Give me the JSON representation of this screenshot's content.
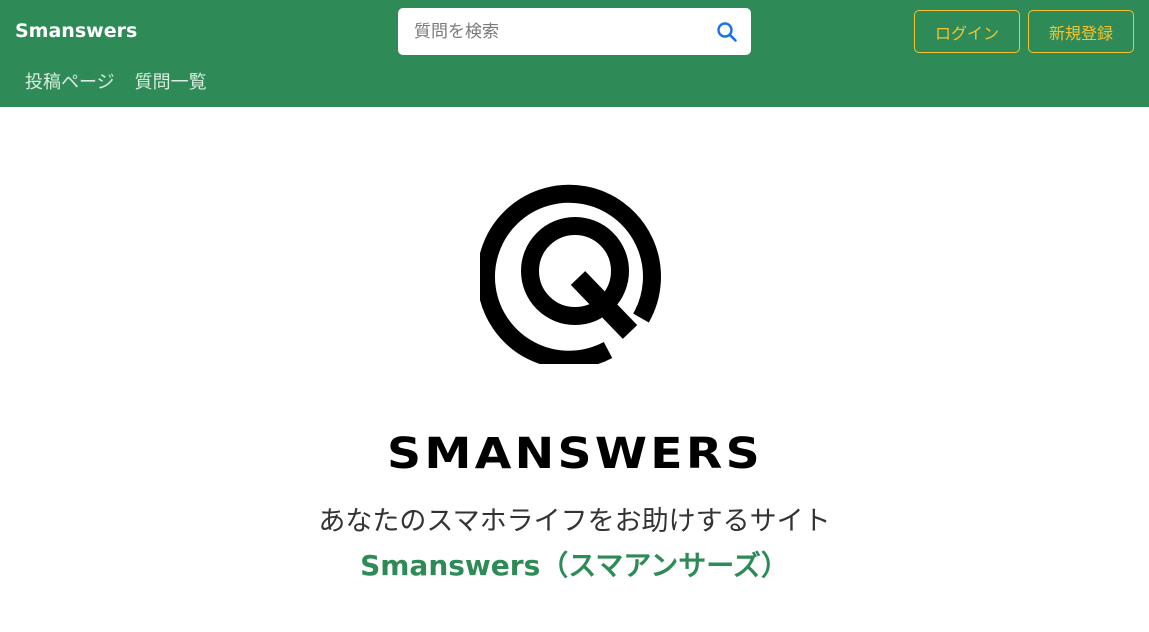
{
  "navbar": {
    "brand": "Smanswers",
    "search": {
      "placeholder": "質問を検索",
      "value": "",
      "icon": "search-icon"
    },
    "login_label": "ログイン",
    "register_label": "新規登録",
    "links": [
      {
        "label": "投稿ページ"
      },
      {
        "label": "質問一覧"
      }
    ],
    "colors": {
      "background": "#2e8b57",
      "accent": "#f4c430"
    }
  },
  "hero": {
    "logo_icon": "q-logo-icon",
    "wordmark": "SMANSWERS",
    "tagline": "あなたのスマホライフをお助けするサイト",
    "site_name": "Smanswers（スマアンサーズ）"
  }
}
